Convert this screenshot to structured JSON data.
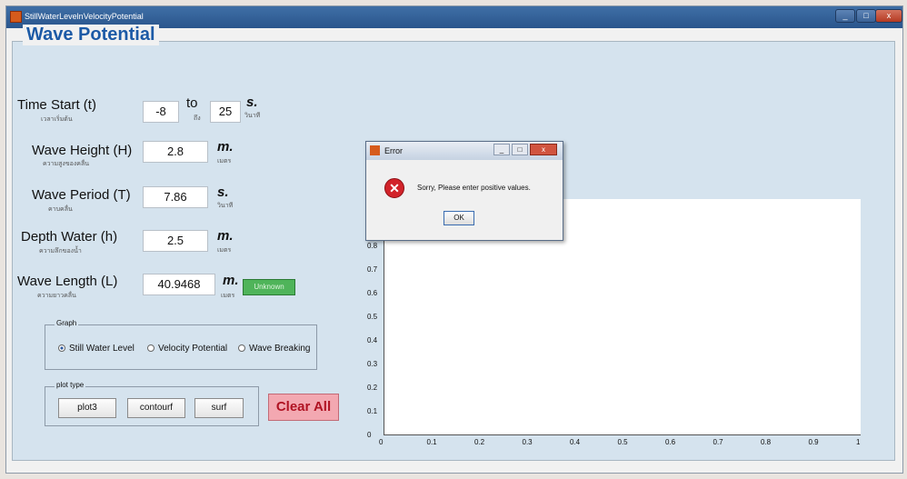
{
  "window": {
    "title": "StillWaterLevelnVelocityPotential",
    "minimize": "_",
    "maximize": "□",
    "close": "x"
  },
  "panel": {
    "title": "Wave Potential"
  },
  "inputs": {
    "time_start": {
      "label": "Time Start (t)",
      "sub": "เวลาเริ่มต้น",
      "value": "-8",
      "to": "to",
      "to_sub": "ถึง",
      "end": "25",
      "unit": "s.",
      "unit_sub": "วินาที"
    },
    "wave_height": {
      "label": "Wave Height (H)",
      "sub": "ความสูงของคลื่น",
      "value": "2.8",
      "unit": "m.",
      "unit_sub": "เมตร"
    },
    "wave_period": {
      "label": "Wave Period (T)",
      "sub": "คาบคลื่น",
      "value": "7.86",
      "unit": "s.",
      "unit_sub": "วินาที"
    },
    "depth_water": {
      "label": "Depth Water (h)",
      "sub": "ความลึกของน้ำ",
      "value": "2.5",
      "unit": "m.",
      "unit_sub": "เมตร"
    },
    "wave_length": {
      "label": "Wave Length (L)",
      "sub": "ความยาวคลื่น",
      "value": "40.9468",
      "unit": "m.",
      "unit_sub": "เมตร",
      "status": "Unknown"
    }
  },
  "graph_group": {
    "caption": "Graph",
    "options": [
      "Still Water Level",
      "Velocity Potential",
      "Wave Breaking"
    ],
    "selected": "Still Water Level"
  },
  "plot_type_group": {
    "caption": "plot type",
    "buttons": [
      "plot3",
      "contourf",
      "surf"
    ]
  },
  "clear_button": "Clear All",
  "chart_data": {
    "type": "line",
    "x_ticks": [
      "0",
      "0.1",
      "0.2",
      "0.3",
      "0.4",
      "0.5",
      "0.6",
      "0.7",
      "0.8",
      "0.9",
      "1"
    ],
    "y_ticks": [
      "0",
      "0.1",
      "0.2",
      "0.3",
      "0.4",
      "0.5",
      "0.6",
      "0.7",
      "0.8"
    ],
    "xlim": [
      0,
      1
    ],
    "ylim": [
      0,
      1
    ],
    "series": []
  },
  "error_dialog": {
    "title": "Error",
    "message": "Sorry, Please enter positive values.",
    "ok": "OK"
  }
}
